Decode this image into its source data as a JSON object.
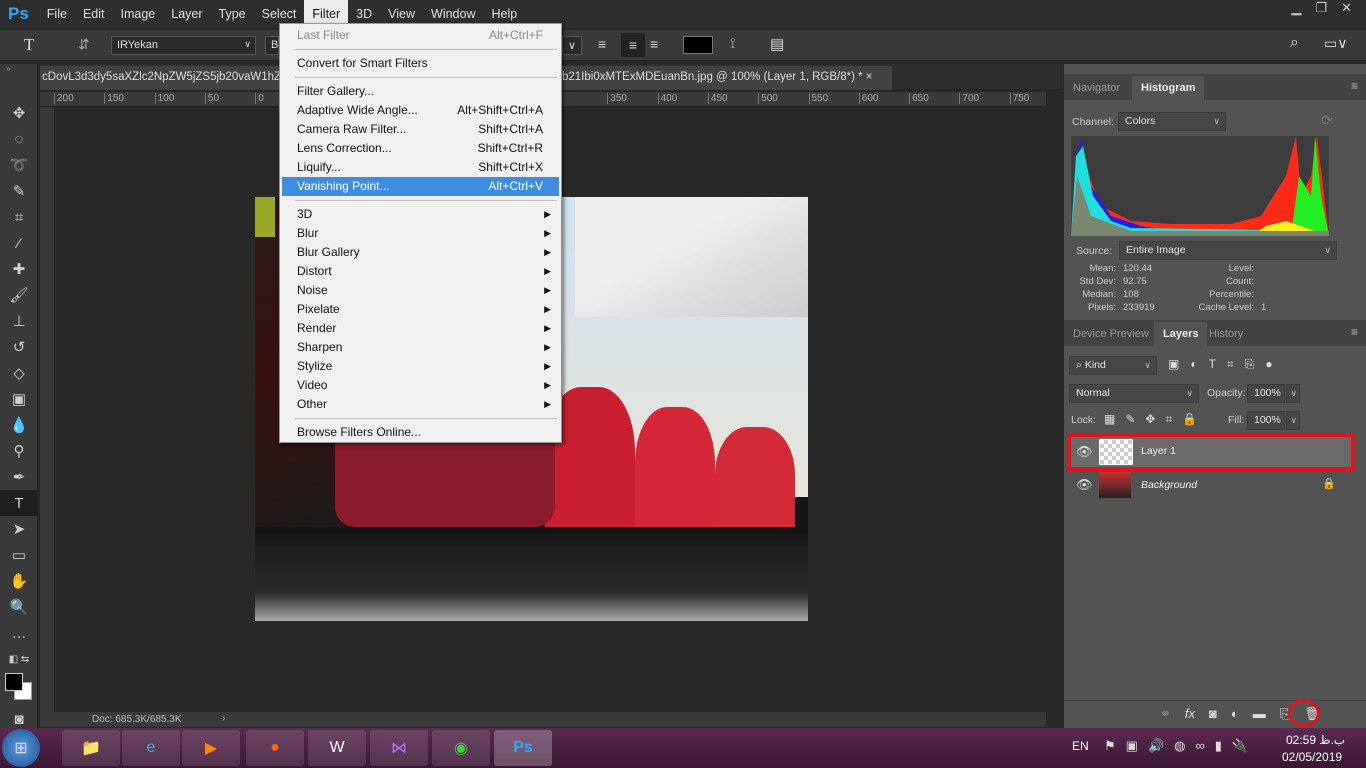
{
  "app": {
    "logo": "Ps"
  },
  "menubar": [
    "File",
    "Edit",
    "Image",
    "Layer",
    "Type",
    "Select",
    "Filter",
    "3D",
    "View",
    "Window",
    "Help"
  ],
  "options": {
    "font_family": "IRYekan",
    "font_style_partial": "B"
  },
  "document": {
    "tab_left": "cDovL3d3dy5saXZlc2NpZW5jZS5jb20vaW1hZ",
    "tab_right": "b21Ibi0xMTExMDEuanBn.jpg @ 100% (Layer 1, RGB/8*) *",
    "close": "×",
    "ruler_ticks": [
      "200",
      "150",
      "100",
      "50",
      "0",
      "",
      "",
      "",
      "",
      "",
      "",
      "350",
      "400",
      "450",
      "500",
      "550",
      "600",
      "650",
      "700",
      "750"
    ],
    "status": "Doc: 685.3K/685.3K"
  },
  "filter_menu": [
    {
      "label": "Last Filter",
      "shortcut": "Alt+Ctrl+F",
      "disabled": true
    },
    {
      "sep": true
    },
    {
      "label": "Convert for Smart Filters"
    },
    {
      "sep": true
    },
    {
      "label": "Filter Gallery..."
    },
    {
      "label": "Adaptive Wide Angle...",
      "shortcut": "Alt+Shift+Ctrl+A"
    },
    {
      "label": "Camera Raw Filter...",
      "shortcut": "Shift+Ctrl+A"
    },
    {
      "label": "Lens Correction...",
      "shortcut": "Shift+Ctrl+R"
    },
    {
      "label": "Liquify...",
      "shortcut": "Shift+Ctrl+X"
    },
    {
      "label": "Vanishing Point...",
      "shortcut": "Alt+Ctrl+V",
      "highlighted": true
    },
    {
      "sep": true
    },
    {
      "label": "3D",
      "submenu": true
    },
    {
      "label": "Blur",
      "submenu": true
    },
    {
      "label": "Blur Gallery",
      "submenu": true
    },
    {
      "label": "Distort",
      "submenu": true
    },
    {
      "label": "Noise",
      "submenu": true
    },
    {
      "label": "Pixelate",
      "submenu": true
    },
    {
      "label": "Render",
      "submenu": true
    },
    {
      "label": "Sharpen",
      "submenu": true
    },
    {
      "label": "Stylize",
      "submenu": true
    },
    {
      "label": "Video",
      "submenu": true
    },
    {
      "label": "Other",
      "submenu": true
    },
    {
      "sep": true
    },
    {
      "label": "Browse Filters Online..."
    }
  ],
  "histogram": {
    "tabs": [
      "Navigator",
      "Histogram"
    ],
    "channel_label": "Channel:",
    "channel": "Colors",
    "source_label": "Source:",
    "source": "Entire Image",
    "stats": [
      [
        "Mean:",
        "120.44",
        "Level:",
        ""
      ],
      [
        "Std Dev:",
        "92.75",
        "Count:",
        ""
      ],
      [
        "Median:",
        "108",
        "Percentile:",
        ""
      ],
      [
        "Pixels:",
        "233919",
        "Cache Level:",
        "1"
      ]
    ]
  },
  "layers": {
    "tabs": [
      "Device Preview",
      "Layers",
      "History"
    ],
    "kind": "Kind",
    "blend": "Normal",
    "opacity_label": "Opacity:",
    "opacity": "100%",
    "lock_label": "Lock:",
    "fill_label": "Fill:",
    "fill": "100%",
    "items": [
      {
        "name": "Layer 1",
        "selected": true
      },
      {
        "name": "Background",
        "locked": true
      }
    ]
  },
  "taskbar": {
    "lang": "EN",
    "time": "02:59 ب.ظ",
    "date": "02/05/2019"
  },
  "colors": {
    "accent": "#3d8ee0",
    "highlight_box": "#e0141e"
  }
}
